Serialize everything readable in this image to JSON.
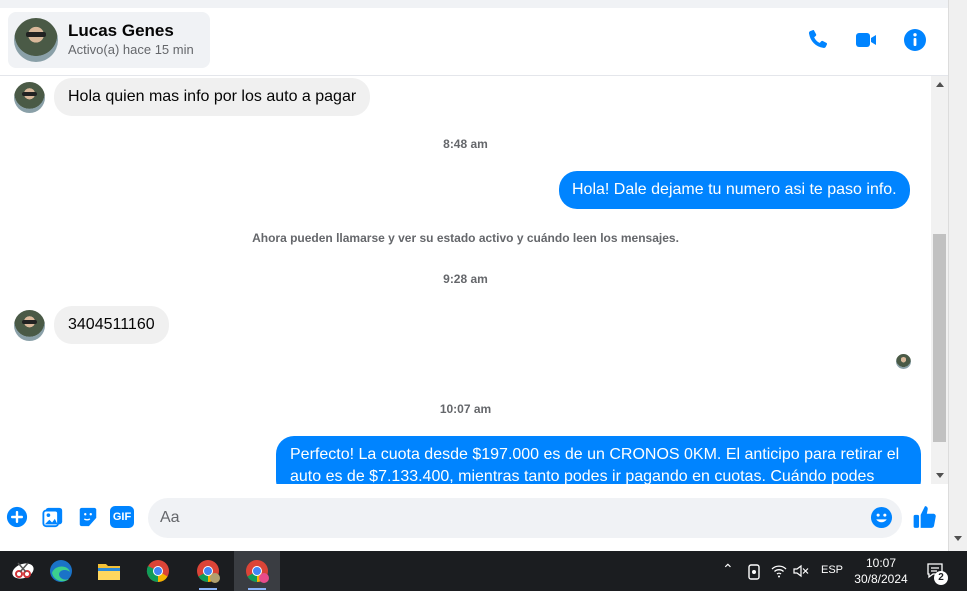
{
  "header": {
    "contact_name": "Lucas Genes",
    "contact_status": "Activo(a) hace 15 min",
    "accent_color": "#0084ff"
  },
  "messages": [
    {
      "direction": "in",
      "text": "Hola quien mas info por los auto a pagar"
    },
    {
      "type": "timestamp",
      "text": "8:48 am"
    },
    {
      "direction": "out",
      "text": "Hola! Dale dejame tu numero  asi te paso info."
    },
    {
      "type": "system",
      "text": "Ahora pueden llamarse y ver su estado activo y cuándo leen los mensajes."
    },
    {
      "type": "timestamp",
      "text": "9:28 am"
    },
    {
      "direction": "in",
      "text": "3404511160"
    },
    {
      "type": "timestamp",
      "text": "10:07 am"
    },
    {
      "direction": "out",
      "text": "Perfecto! La cuota desde $197.000 es de un CRONOS 0KM. El anticipo para retirar el auto es de $7.133.400, mientras tanto podes ir pagando en cuotas. Cuándo podes"
    }
  ],
  "composer": {
    "placeholder": "Aa",
    "icons": [
      "plus-icon",
      "image-icon",
      "sticker-icon",
      "gif-icon",
      "emoji-icon",
      "thumbs-up-icon"
    ],
    "gif_label": "GIF"
  },
  "taskbar": {
    "apps": [
      "snipping-tool-icon",
      "edge-icon",
      "file-explorer-icon",
      "chrome-icon",
      "chrome-profile-icon",
      "chrome-profile-c-icon"
    ],
    "language": "ESP",
    "time": "10:07",
    "date": "30/8/2024",
    "notification_count": "2"
  }
}
